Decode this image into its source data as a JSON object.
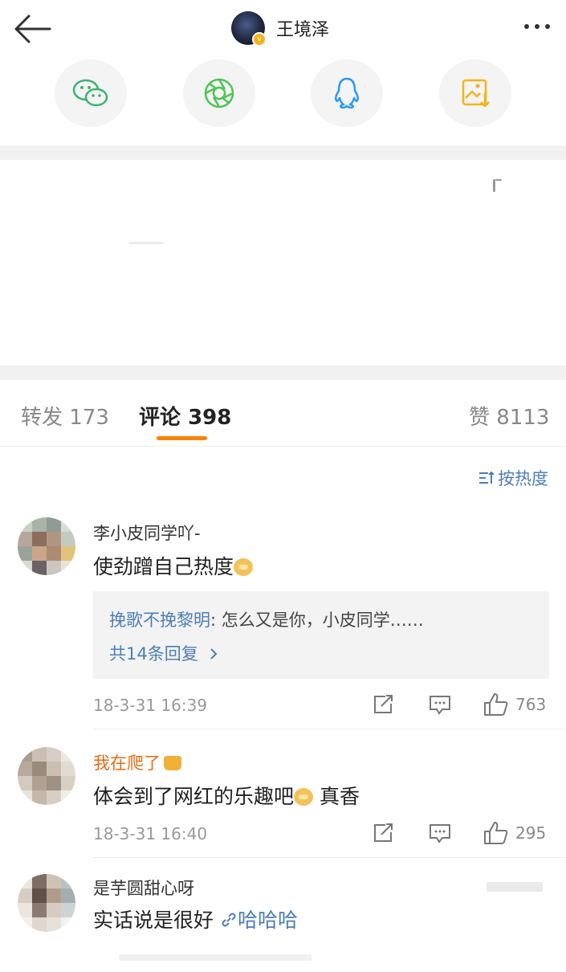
{
  "header": {
    "title": "王境泽"
  },
  "share": {
    "icons": [
      "wechat-icon",
      "moments-icon",
      "qq-icon",
      "save-image-icon"
    ],
    "colors": [
      "#3cb371",
      "#4cc552",
      "#2a9bf0",
      "#f5b31a"
    ]
  },
  "tabs": [
    {
      "label": "转发",
      "count": "173"
    },
    {
      "label": "评论",
      "count": "398"
    },
    {
      "label": "赞",
      "count": "8113"
    }
  ],
  "sort": {
    "label": "按热度"
  },
  "comments": [
    {
      "user": "李小皮同学吖-",
      "text": "使劲蹭自己热度",
      "reply": {
        "user": "挽歌不挽黎明",
        "text": ": 怎么又是你，小皮同学……",
        "more": "共14条回复"
      },
      "time": "18-3-31 16:39",
      "likes": "763"
    },
    {
      "user": "我在爬了",
      "text_before": "体会到了网红的乐趣吧",
      "text_after": " 真香",
      "time": "18-3-31 16:40",
      "likes": "295"
    },
    {
      "user": "是芋圆甜心呀",
      "text": "实话说是很好",
      "link": "哈哈哈"
    }
  ],
  "colors": {
    "accent": "#ff8200",
    "link": "#4d7eb6"
  }
}
